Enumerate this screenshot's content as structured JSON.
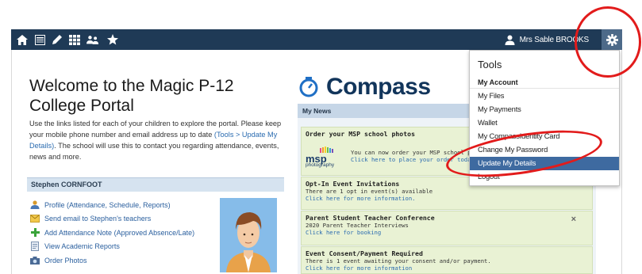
{
  "nav": {
    "icons": [
      "home-icon",
      "calendar-icon",
      "pencil-icon",
      "grid-icon",
      "people-icon",
      "star-icon"
    ],
    "user_name": "Mrs Sable BROOKS",
    "user_icon": "person-icon",
    "settings_icon": "gear-icon"
  },
  "welcome": {
    "title": "Welcome to the Magic P-12 College Portal",
    "text_before": "Use the links listed for each of your children to explore the portal. Please keep your mobile phone number and email address up to date ",
    "link_text": "(Tools > Update My Details)",
    "text_after": ". The school will use this to contact you regarding attendance, events, news and more."
  },
  "student": {
    "name": "Stephen CORNFOOT",
    "links": [
      {
        "label": "Profile (Attendance, Schedule, Reports)",
        "icon": "profile-icon"
      },
      {
        "label": "Send email to Stephen's teachers",
        "icon": "email-icon"
      },
      {
        "label": "Add Attendance Note (Approved Absence/Late)",
        "icon": "plus-icon"
      },
      {
        "label": "View Academic Reports",
        "icon": "report-icon"
      },
      {
        "label": "Order Photos",
        "icon": "camera-icon"
      }
    ]
  },
  "compass": {
    "logo_text": "Compass",
    "news_header": "My News",
    "news": [
      {
        "title": "Order your MSP school photos",
        "body": "You can now order your MSP school pho",
        "link": "Click here to place your order today!",
        "logo_top": "msp",
        "logo_bottom": "photography"
      },
      {
        "title": "Opt-In Event Invitations",
        "body": "There are 1 opt in event(s) available",
        "link": "Click here for more information."
      },
      {
        "title": "Parent Student Teacher Conference",
        "body": "2020 Parent Teacher Interviews",
        "link": "Click here for booking",
        "close": "×"
      },
      {
        "title": "Event Consent/Payment Required",
        "body": "There is 1 event awaiting your consent and/or payment.",
        "link": "Click here for more information"
      }
    ]
  },
  "tools_menu": {
    "heading": "Tools",
    "section": "My Account",
    "items": [
      "My Files",
      "My Payments",
      "Wallet",
      "My CompassIdentity Card",
      "Change My Password",
      "Update My Details",
      "Logout"
    ],
    "active_item": "Update My Details"
  },
  "annotation_color": "#e21b1b"
}
